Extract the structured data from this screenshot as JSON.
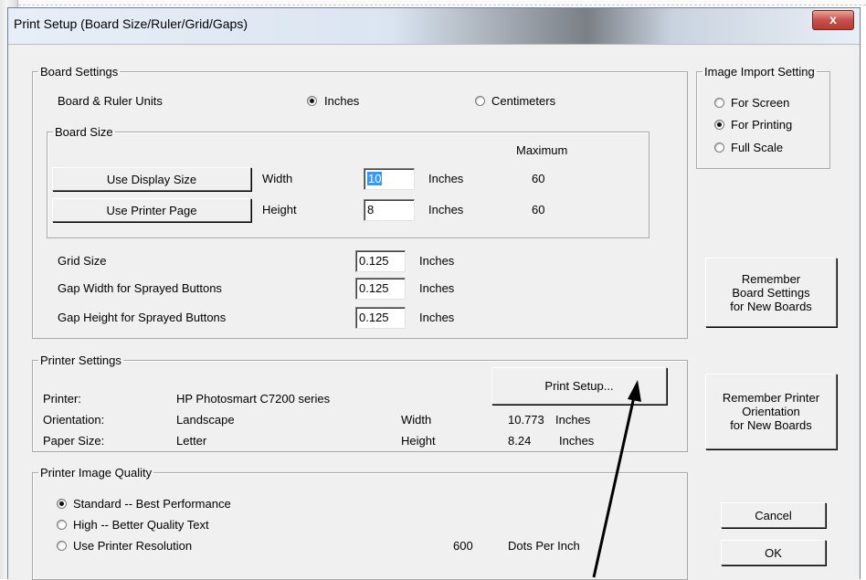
{
  "window": {
    "title": "Print Setup (Board Size/Ruler/Grid/Gaps)",
    "close_glyph": "x"
  },
  "board_settings": {
    "legend": "Board Settings",
    "units_label": "Board & Ruler Units",
    "unit_inches": "Inches",
    "unit_centimeters": "Centimeters",
    "selected_unit": "Inches",
    "board_size": {
      "legend": "Board Size",
      "maximum_label": "Maximum",
      "use_display_size": "Use Display Size",
      "use_printer_page": "Use Printer Page",
      "width_label": "Width",
      "height_label": "Height",
      "width_value": "10",
      "height_value": "8",
      "width_unit": "Inches",
      "height_unit": "Inches",
      "width_max": "60",
      "height_max": "60"
    },
    "grid_size_label": "Grid Size",
    "grid_size_value": "0.125",
    "grid_size_unit": "Inches",
    "gap_width_label": "Gap Width for Sprayed Buttons",
    "gap_width_value": "0.125",
    "gap_width_unit": "Inches",
    "gap_height_label": "Gap Height for Sprayed Buttons",
    "gap_height_value": "0.125",
    "gap_height_unit": "Inches"
  },
  "image_import": {
    "legend": "Image Import Setting",
    "options": [
      "For Screen",
      "For Printing",
      "Full Scale"
    ],
    "selected": "For Printing"
  },
  "remember_board_button": "Remember\nBoard Settings\nfor New Boards",
  "printer_settings": {
    "legend": "Printer Settings",
    "print_setup_button": "Print Setup...",
    "printer_label": "Printer:",
    "printer_value": "HP Photosmart C7200 series",
    "orientation_label": "Orientation:",
    "orientation_value": "Landscape",
    "paper_label": "Paper Size:",
    "paper_value": "Letter",
    "width_label": "Width",
    "width_value": "10.773",
    "width_unit": "Inches",
    "height_label": "Height",
    "height_value": "8.24",
    "height_unit": "Inches"
  },
  "remember_printer_button": "Remember Printer\nOrientation\nfor New Boards",
  "image_quality": {
    "legend": "Printer Image Quality",
    "options": [
      "Standard  --  Best Performance",
      "High  --  Better Quality Text",
      "Use Printer Resolution"
    ],
    "selected": "Standard  --  Best Performance",
    "dpi_value": "600",
    "dpi_unit": "Dots Per Inch"
  },
  "cancel_button": "Cancel",
  "ok_button": "OK",
  "colors": {
    "dialog_bg": "#f0f0f0",
    "close_red": "#c75050",
    "selection_blue": "#3399ff"
  }
}
